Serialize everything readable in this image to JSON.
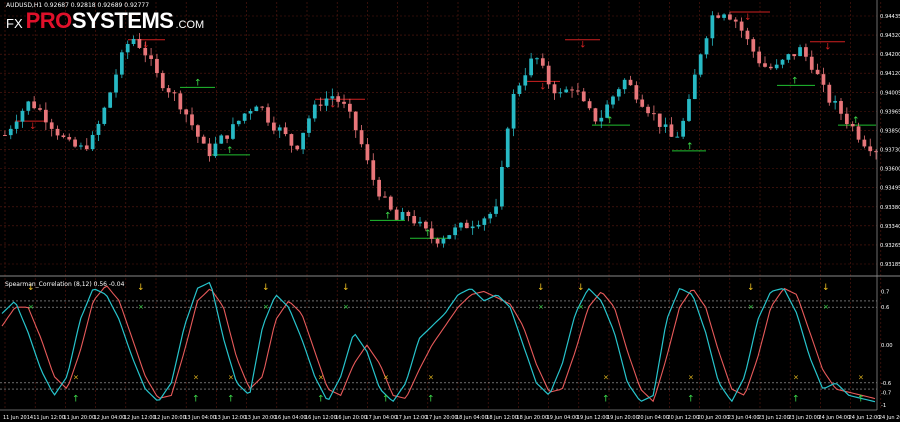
{
  "symbol_header": "AUDUSD,H1  0.92687 0.92818 0.92689 0.92777",
  "logo": {
    "fx": "FX",
    "pro": "PRO",
    "systems": "SYSTEMS",
    "com": ".COM"
  },
  "indicator_label": "Spearman_Correlation (8,12) 0.56 -0.04",
  "colors": {
    "background": "#000000",
    "grid": "#5a1a12",
    "bull_candle": "#27b9c4",
    "bear_candle": "#e8767a",
    "fast_line": "#27c4cc",
    "slow_line": "#e85a5a",
    "arrow_up": "#3ddc4a",
    "arrow_down": "#f0c020",
    "level_red": "#d02020",
    "level_green": "#20c030",
    "axis_text": "#ffffff"
  },
  "price_axis_labels": [
    "0.94435",
    "0.94320",
    "0.94200",
    "0.94120",
    "0.94005",
    "0.93965",
    "0.93850",
    "0.93730",
    "0.93600",
    "0.93495",
    "0.93380",
    "0.93340",
    "0.93265",
    "0.93185"
  ],
  "indicator_axis_labels": [
    "0.7",
    "0.6",
    "0.00",
    "-0.6",
    "-0.7",
    "-1"
  ],
  "time_axis_labels": [
    "11 Jun 2014",
    "11 Jun 12:00",
    "11 Jun 20:00",
    "12 Jun 04:00",
    "12 Jun 12:00",
    "12 Jun 20:00",
    "13 Jun 04:00",
    "13 Jun 12:00",
    "13 Jun 20:00",
    "16 Jun 04:00",
    "16 Jun 12:00",
    "16 Jun 20:00",
    "17 Jun 04:00",
    "17 Jun 12:00",
    "17 Jun 20:00",
    "18 Jun 04:00",
    "18 Jun 12:00",
    "18 Jun 20:00",
    "19 Jun 04:00",
    "19 Jun 12:00",
    "19 Jun 20:00",
    "20 Jun 04:00",
    "20 Jun 12:00",
    "20 Jun 20:00",
    "23 Jun 04:00",
    "23 Jun 12:00",
    "23 Jun 20:00",
    "24 Jun 04:00",
    "24 Jun 12:00",
    "24 Jun 20:00"
  ],
  "chart_data": {
    "type": "candlestick+line",
    "price_keys": [
      0.9385,
      0.9395,
      0.9402,
      0.9396,
      0.9388,
      0.938,
      0.9378,
      0.9383,
      0.94,
      0.942,
      0.9435,
      0.9428,
      0.9415,
      0.9408,
      0.94,
      0.9388,
      0.9375,
      0.9382,
      0.9388,
      0.9396,
      0.9402,
      0.9392,
      0.9386,
      0.9378,
      0.9393,
      0.9402,
      0.9405,
      0.9398,
      0.9385,
      0.9365,
      0.9352,
      0.9342,
      0.9345,
      0.9338,
      0.9332,
      0.9335,
      0.9338,
      0.9341,
      0.9344,
      0.9347,
      0.94,
      0.9415,
      0.9425,
      0.9412,
      0.9405,
      0.941,
      0.9398,
      0.9392,
      0.9403,
      0.9413,
      0.9406,
      0.9398,
      0.939,
      0.9382,
      0.9395,
      0.9425,
      0.9445,
      0.9448,
      0.9442,
      0.943,
      0.942,
      0.9418,
      0.9424,
      0.9428,
      0.942,
      0.9405,
      0.9398,
      0.939,
      0.9382,
      0.9378
    ],
    "price_range": [
      0.9318,
      0.945
    ],
    "fast_keys": [
      0.5,
      0.7,
      0.2,
      -0.4,
      -0.8,
      -0.5,
      0.4,
      0.9,
      0.8,
      0.4,
      -0.2,
      -0.7,
      -0.9,
      -0.6,
      0.3,
      0.9,
      1.0,
      0.1,
      -0.6,
      -0.8,
      0.3,
      0.8,
      0.6,
      0.1,
      -0.5,
      -0.9,
      -0.5,
      0.2,
      -0.1,
      -0.7,
      -0.9,
      -0.6,
      0.1,
      0.3,
      0.5,
      0.8,
      0.9,
      0.7,
      0.8,
      0.6,
      0.0,
      -0.6,
      -0.8,
      -0.3,
      0.5,
      0.9,
      0.7,
      0.2,
      -0.6,
      -0.9,
      -0.8,
      0.4,
      0.9,
      0.8,
      0.2,
      -0.6,
      -0.9,
      -0.5,
      0.4,
      0.85,
      0.9,
      0.5,
      -0.2,
      -0.7,
      -0.6,
      -0.8,
      -0.85,
      -0.9
    ],
    "slow_keys": [
      0.3,
      0.6,
      0.6,
      0.1,
      -0.5,
      -0.7,
      -0.1,
      0.7,
      0.95,
      0.7,
      0.1,
      -0.5,
      -0.85,
      -0.8,
      -0.1,
      0.7,
      0.9,
      0.6,
      -0.2,
      -0.7,
      -0.5,
      0.4,
      0.7,
      0.5,
      -0.1,
      -0.7,
      -0.8,
      -0.3,
      0.0,
      -0.3,
      -0.8,
      -0.85,
      -0.4,
      0.0,
      0.3,
      0.6,
      0.8,
      0.85,
      0.75,
      0.65,
      0.3,
      -0.3,
      -0.75,
      -0.7,
      -0.1,
      0.6,
      0.85,
      0.6,
      -0.1,
      -0.7,
      -0.9,
      -0.2,
      0.6,
      0.9,
      0.6,
      -0.1,
      -0.7,
      -0.8,
      -0.2,
      0.6,
      0.9,
      0.8,
      0.2,
      -0.4,
      -0.7,
      -0.75,
      -0.8,
      -0.85
    ],
    "indicator_range": [
      -1.0,
      1.0
    ],
    "levels": [
      0.7,
      0.6,
      -0.6,
      -0.7
    ]
  }
}
